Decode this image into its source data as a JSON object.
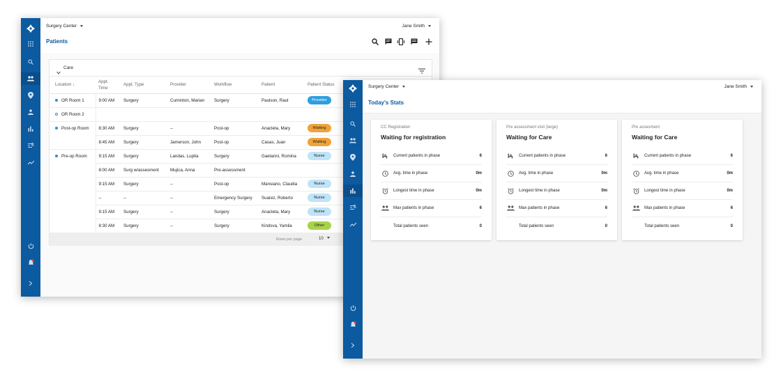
{
  "colors": {
    "brand": "#0c5aa0",
    "provider_pill": "#2b9fe0",
    "waiting_pill": "#f0a23a",
    "nurse_pill": "#bfe3f7",
    "other_pill": "#a8d24a"
  },
  "patients_window": {
    "org": "Surgery Center",
    "user": "Jane Smith",
    "title": "Patients",
    "toolbar_icons": [
      "search-icon",
      "message-icon",
      "vibrate-icon",
      "chat-icon",
      "add-icon"
    ],
    "section": "Care",
    "columns": [
      "Location",
      "Appt. Time",
      "Appt. Type",
      "Provider",
      "Workflow",
      "Patient",
      "Patient Status"
    ],
    "rows": [
      {
        "location": "OR Room 1",
        "dot": "filled",
        "time": "9:00 AM",
        "type": "Surgery",
        "provider": "Curninton, Marian",
        "workflow": "Surgery",
        "patient": "Paulson, Raul",
        "status": "Provider",
        "status_kind": "provider"
      },
      {
        "location": "OR Room 2",
        "dot": "empty",
        "time": "",
        "type": "",
        "provider": "",
        "workflow": "",
        "patient": "",
        "status": "",
        "status_kind": ""
      },
      {
        "location": "Post-op Room",
        "dot": "filled",
        "time": "8:30 AM",
        "type": "Surgery",
        "provider": "--",
        "workflow": "Post-op",
        "patient": "Anacleta, Mary",
        "status": "Waiting",
        "status_kind": "waiting"
      },
      {
        "location": "",
        "dot": "",
        "time": "8:45 AM",
        "type": "Surgery",
        "provider": "Jamerson, John",
        "workflow": "Post-op",
        "patient": "Casas, Juan",
        "status": "Waiting",
        "status_kind": "waiting"
      },
      {
        "location": "Pre-op Room",
        "dot": "filled",
        "time": "9:15 AM",
        "type": "Surgery",
        "provider": "Landas, Lupita",
        "workflow": "Surgery",
        "patient": "Gaetanni, Romina",
        "status": "Nurse",
        "status_kind": "nurse"
      },
      {
        "location": "",
        "dot": "",
        "time": "8:00 AM",
        "type": "Surg w/assesment",
        "provider": "Mujica, Anna",
        "workflow": "Pre-assessment",
        "patient": "",
        "status": "",
        "status_kind": ""
      },
      {
        "location": "",
        "dot": "",
        "time": "9:15 AM",
        "type": "Surgery",
        "provider": "--",
        "workflow": "Post-op",
        "patient": "Mansiano, Claudia",
        "status": "Nurse",
        "status_kind": "nurse"
      },
      {
        "location": "",
        "dot": "",
        "time": "--",
        "type": "--",
        "provider": "--",
        "workflow": "Emergency Surgery",
        "patient": "Suarez, Roberto",
        "status": "Nurse",
        "status_kind": "nurse"
      },
      {
        "location": "",
        "dot": "",
        "time": "9:15 AM",
        "type": "Surgery",
        "provider": "--",
        "workflow": "Surgery",
        "patient": "Anacleta, Mary",
        "status": "Nurse",
        "status_kind": "nurse"
      },
      {
        "location": "",
        "dot": "",
        "time": "8:30 AM",
        "type": "Surgery",
        "provider": "--",
        "workflow": "Surgery",
        "patient": "Kindsva, Yamila",
        "status": "Other",
        "status_kind": "other"
      }
    ],
    "rows_per_page_label": "Rows per page",
    "rows_per_page_value": "10"
  },
  "stats_window": {
    "org": "Surgery Center",
    "user": "Jane Smith",
    "title": "Today's Stats",
    "cards": [
      {
        "subtitle": "CC Registration",
        "heading": "Waiting for registration",
        "stats": [
          {
            "icon": "chair-icon",
            "label": "Current patients in phase",
            "value": "6"
          },
          {
            "icon": "clock-icon",
            "label": "Avg. time in phase",
            "value": "0m"
          },
          {
            "icon": "alarm-icon",
            "label": "Longest time in phase",
            "value": "0m"
          },
          {
            "icon": "people-icon",
            "label": "Max patients in phase",
            "value": "6"
          },
          {
            "icon": "",
            "label": "Total patients seen",
            "value": "0"
          }
        ]
      },
      {
        "subtitle": "Pre assessment visit (large)",
        "heading": "Waiting for Care",
        "stats": [
          {
            "icon": "chair-icon",
            "label": "Current patients in phase",
            "value": "6"
          },
          {
            "icon": "clock-icon",
            "label": "Avg. time in phase",
            "value": "0m"
          },
          {
            "icon": "alarm-icon",
            "label": "Longest time in phase",
            "value": "0m"
          },
          {
            "icon": "people-icon",
            "label": "Max patients in phase",
            "value": "6"
          },
          {
            "icon": "",
            "label": "Total patients seen",
            "value": "0"
          }
        ]
      },
      {
        "subtitle": "Pre assesment",
        "heading": "Waiting for Care",
        "stats": [
          {
            "icon": "chair-icon",
            "label": "Current patients in phase",
            "value": "6"
          },
          {
            "icon": "clock-icon",
            "label": "Avg. time in phase",
            "value": "0m"
          },
          {
            "icon": "alarm-icon",
            "label": "Longest time in phase",
            "value": "0m"
          },
          {
            "icon": "people-icon",
            "label": "Max patients in phase",
            "value": "6"
          },
          {
            "icon": "",
            "label": "Total patients seen",
            "value": "0"
          }
        ]
      }
    ]
  },
  "rail_icons": [
    "logo-icon",
    "apps-icon",
    "search-icon",
    "people-icon",
    "location-icon",
    "person-icon",
    "bar-chart-icon",
    "tune-icon",
    "trend-icon",
    "power-icon",
    "notifications-icon",
    "expand-icon"
  ]
}
